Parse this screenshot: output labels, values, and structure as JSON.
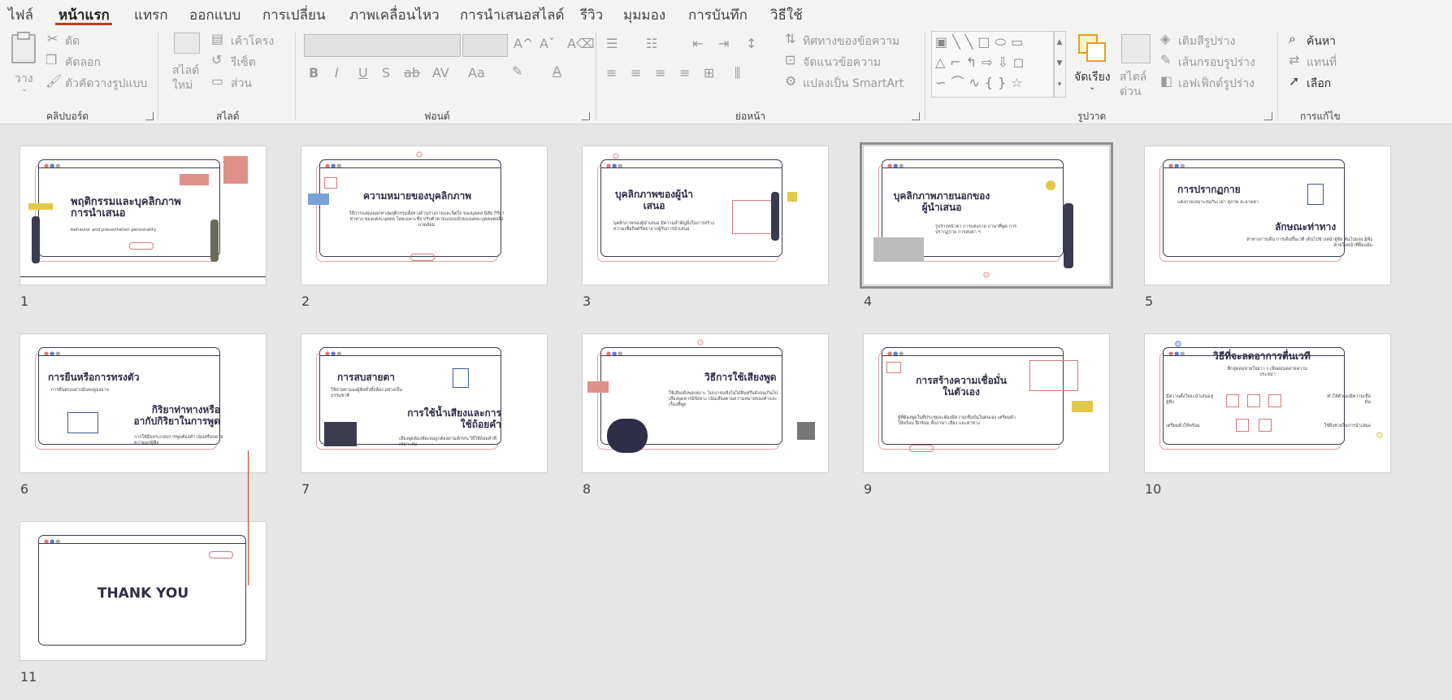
{
  "menu": [
    "ไฟล์",
    "หน้าแรก",
    "แทรก",
    "ออกแบบ",
    "การเปลี่ยน",
    "ภาพเคลื่อนไหว",
    "การนำเสนอสไลด์",
    "รีวิว",
    "มุมมอง",
    "การบันทึก",
    "วิธีใช้"
  ],
  "ribbon": {
    "clipboard": {
      "paste": "วาง",
      "cut": "ตัด",
      "copy": "คัดลอก",
      "format_painter": "ตัวคัดวางรูปแบบ",
      "label": "คลิปบอร์ด"
    },
    "slides": {
      "new_slide_1": "สไลด์",
      "new_slide_2": "ใหม่",
      "layout": "เค้าโครง",
      "reset": "รีเซ็ต",
      "section": "ส่วน",
      "label": "สไลด์"
    },
    "font": {
      "label": "ฟอนต์",
      "bold": "B",
      "italic": "I",
      "underline": "U",
      "shadow": "S",
      "strike": "ab",
      "spacing": "AV",
      "case": "Aa"
    },
    "paragraph": {
      "text_direction": "ทิศทางของข้อความ",
      "align_text": "จัดแนวข้อความ",
      "smartart": "แปลงเป็น SmartArt",
      "label": "ย่อหน้า"
    },
    "drawing": {
      "arrange": "จัดเรียง",
      "quick_styles_1": "สไตล์",
      "quick_styles_2": "ด่วน",
      "fill": "เติมสีรูปร่าง",
      "outline": "เส้นกรอบรูปร่าง",
      "effects": "เอฟเฟ็กต์รูปร่าง",
      "label": "รูปวาด"
    },
    "editing": {
      "find": "ค้นหา",
      "replace": "แทนที่",
      "select": "เลือก",
      "label": "การแก้ไข"
    }
  },
  "slides": [
    {
      "num": "1",
      "title": "พฤติกรรมและบุคลิกภาพการนำเสนอ",
      "body": "behavior and presentation personality"
    },
    {
      "num": "2",
      "title": "ความหมายของบุคลิกภาพ",
      "body": "วิธีการแสดงออกทางพฤติกรรมทั้งทางด้านร่างกายและจิตใจ ของบุคคล นิสัย กิริยาท่าทาง ของแต่ละบุคคล โดยเฉพาะซึ่ง ปรับตัวตามแบบฉบับของแต่ละบุคคลต่อสิ่งแวดล้อม"
    },
    {
      "num": "3",
      "title": "บุคลิกภาพของผู้นำเสนอ",
      "body": "บุคลิกภาพของผู้นำเสนอ มีความสำคัญยิ่งในการสร้างความเชื่อถือศรัทธาจากผู้รับการนำเสนอ"
    },
    {
      "num": "4",
      "title": "บุคลิกภาพภายนอกของผู้นำเสนอ",
      "body": "รูปร่างหน้าตา การแต่งกาย ภาษาที่พูด การปรากฏกาย การสบตา ฯ"
    },
    {
      "num": "5",
      "title": "การปรากฏกาย",
      "title2": "ลักษณะท่าทาง",
      "body": "แต่งกายเหมาะสมกับเวลา สุภาพ สะอาดตา",
      "body2": "ท่าทางการเดิน การเดินขึ้นเวที เดินไปข้างหน้าผู้ฟัง หันไปมอง ผู้ฟังด้วยใบหน้าที่ยิ้มแย้ม"
    },
    {
      "num": "6",
      "title": "การยืนหรือการทรงตัว",
      "title2": "กิริยาท่าทางหรืออากัปกิริยาในการพูด",
      "body": "การยืนตรงอย่างมั่นคงดูองอาจ",
      "body2": "การใช้มือประกอบการพูดต้องทำ เน้นหรือขยายความแก่ผู้ฟัง"
    },
    {
      "num": "7",
      "title": "การสบสายตา",
      "title2": "การใช้น้ำเสียงและการใช้ถ้อยคำ",
      "body": "ใช้สายตามองผู้ฟังทั่วทั้งห้อง อย่างเป็นธรรมชาติ",
      "body2": "เสียงพูดต้องชัดเจนถูกต้องตามอักขระวิธีใช้ถ้อยคำที่เหมาะสม"
    },
    {
      "num": "8",
      "title": "วิธีการใช้เสียงพูด",
      "body": "ใช้เสียงดังพอเหมาะ ไม่เบาจนฟังไม่ได้ยินหรือดังจนเกินไป เสียงพูดควรมีจังหวะ เน้นเสียงตามความหมายของคำและเรื่องที่พูด"
    },
    {
      "num": "9",
      "title": "การสร้างความเชื่อมั่นในตัวเอง",
      "body": "ผู้ที่ต้องพูดในที่ประชุมจะต้องมีความเชื่อมั่นในตนเอง เตรียมตัวให้พร้อม ฝึกซ้อม ทั้งภาษา เสียง และท่าทาง"
    },
    {
      "num": "10",
      "title": "วิธีที่จะลดอาการตื่นเวที",
      "body": "ฝึกสูดลมหายใจยาว ๆ เพื่อผ่อนคลายความประหม่า",
      "items": [
        "มีความตั้งใจจะนำเสนอสู่ผู้ฟัง",
        "ทำให้ตัวเองมีความเชื่อมั่น",
        "เตรียมตัวให้พร้อม",
        "ใช้สิ่งช่วยในการนำเสนอ"
      ]
    },
    {
      "num": "11",
      "title": "THANK YOU"
    }
  ],
  "colors": {
    "accent": "#c43e1c",
    "frame": "#3b3b4f",
    "pink": "#d47a7a",
    "blue": "#5b7bd5",
    "yellow": "#e3c94a"
  }
}
